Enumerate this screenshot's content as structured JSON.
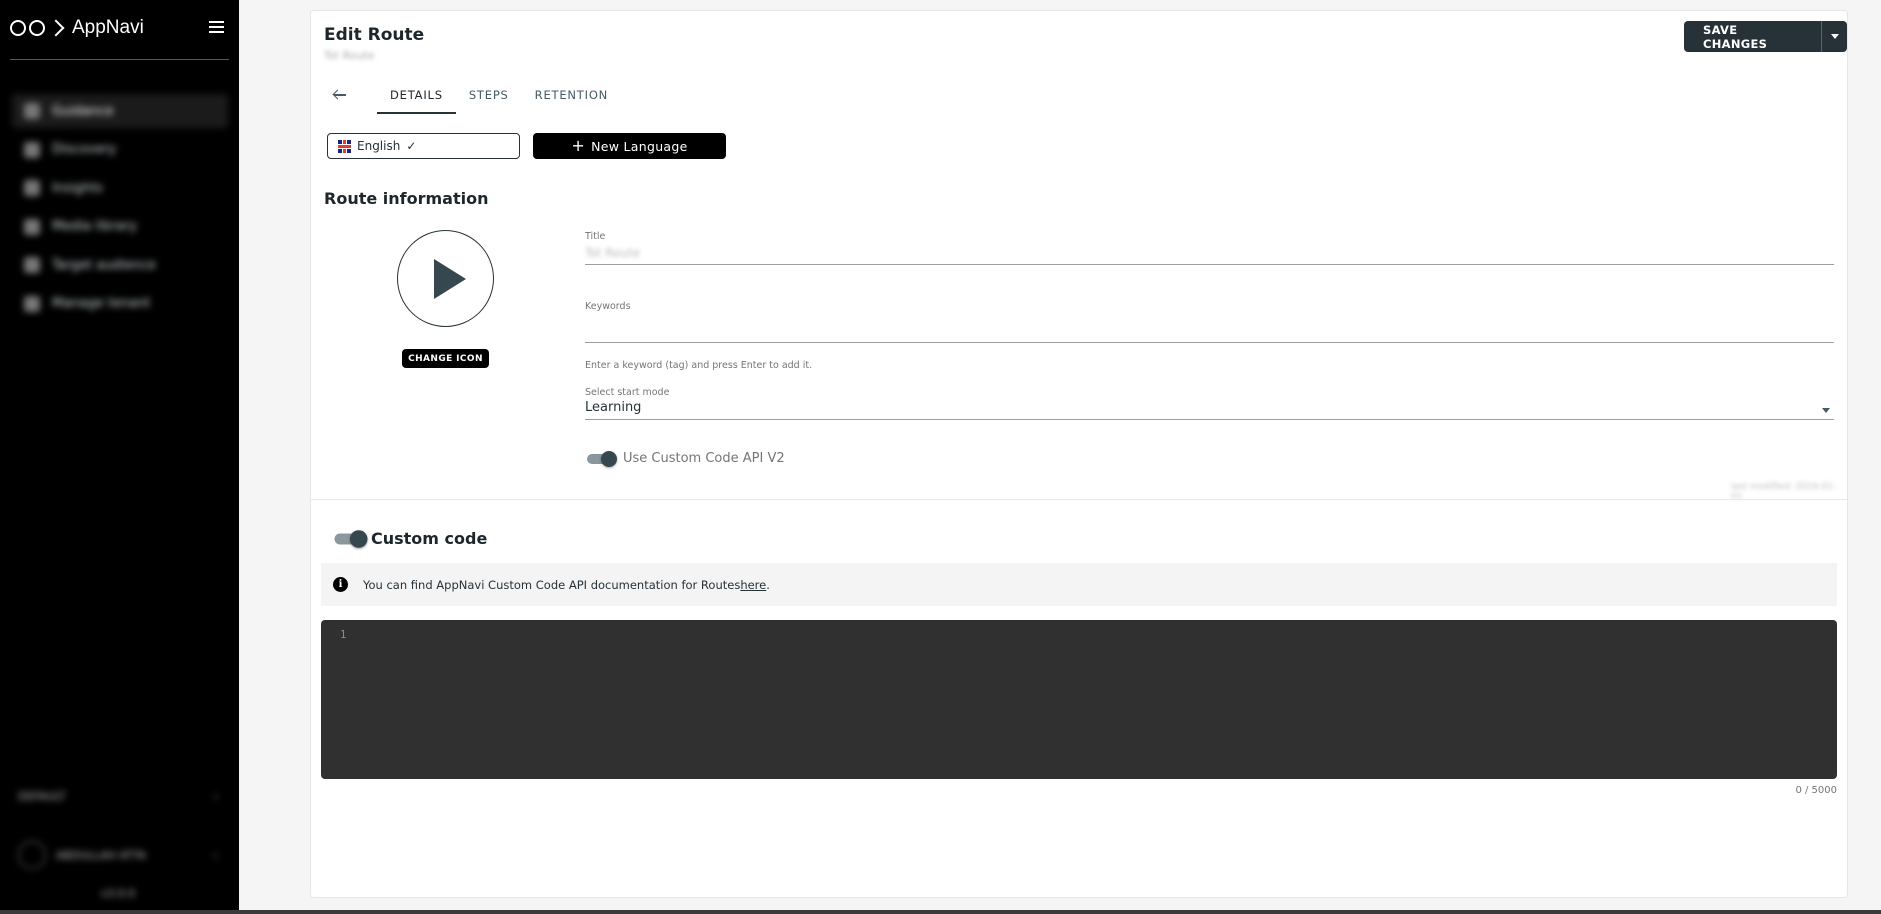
{
  "sidebar": {
    "brand": "AppNavi",
    "nav_items": [
      "Guidance",
      "Discovery",
      "Insights",
      "Media library",
      "Target audience",
      "Manage tenant"
    ],
    "bottom": {
      "section": "DEFAULT",
      "user": "ABDULLAH ATTA",
      "version": "v3.0.0"
    }
  },
  "header": {
    "title": "Edit Route",
    "subtitle": "Tst Route",
    "save_label": "SAVE CHANGES"
  },
  "tabs": [
    {
      "label": "DETAILS",
      "active": true
    },
    {
      "label": "STEPS",
      "active": false
    },
    {
      "label": "RETENTION",
      "active": false
    }
  ],
  "language": {
    "current": "English",
    "check": "✓",
    "new_label": "New Language",
    "plus": "+"
  },
  "route_info": {
    "section_title": "Route information",
    "change_icon_label": "CHANGE ICON",
    "title_label": "Title",
    "title_value": "Tst Route",
    "keywords_label": "Keywords",
    "keywords_value": "",
    "keywords_helper": "Enter a keyword (tag) and press Enter to add it.",
    "start_mode_label": "Select start mode",
    "start_mode_value": "Learning",
    "custom_code_api_label": "Use Custom Code API V2",
    "custom_code_api_enabled": true,
    "blurred_right_text": "last modified: 2024-01-01"
  },
  "custom_code": {
    "title": "Custom code",
    "enabled": true,
    "info_icon_glyph": "i",
    "info_text": "You can find AppNavi Custom Code API documentation for Routes ",
    "info_link": "here",
    "info_suffix": ".",
    "editor_line_number": "1",
    "char_count": "0 / 5000"
  },
  "colors": {
    "sidebar_bg": "#000000",
    "primary": "#263238",
    "editor_bg": "#303030",
    "page_bg": "#f5f5f5"
  }
}
